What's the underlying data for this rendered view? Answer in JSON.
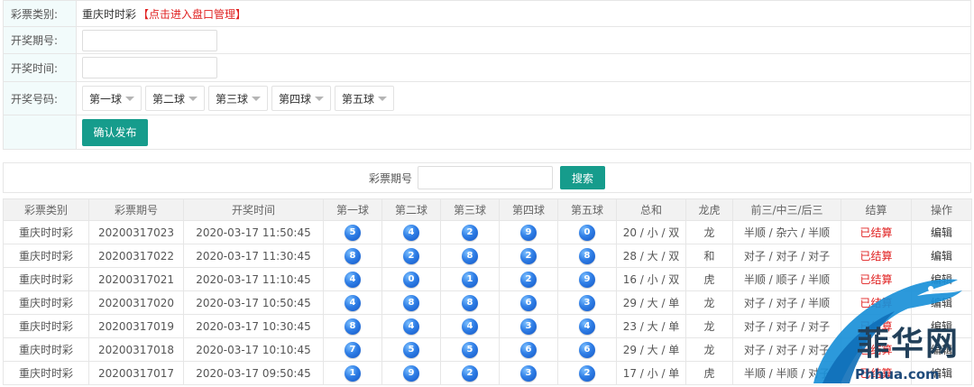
{
  "form": {
    "lottery_type_label": "彩票类别:",
    "lottery_name": "重庆时时彩",
    "lottery_link": "【点击进入盘口管理】",
    "issue_label": "开奖期号:",
    "issue_value": "",
    "time_label": "开奖时间:",
    "time_value": "",
    "numbers_label": "开奖号码:",
    "ball_selects": [
      "第一球",
      "第二球",
      "第三球",
      "第四球",
      "第五球"
    ],
    "publish_button": "确认发布"
  },
  "search": {
    "label": "彩票期号",
    "value": "",
    "button": "搜索"
  },
  "table": {
    "headers": [
      "彩票类别",
      "彩票期号",
      "开奖时间",
      "第一球",
      "第二球",
      "第三球",
      "第四球",
      "第五球",
      "总和",
      "龙虎",
      "前三/中三/后三",
      "结算",
      "操作"
    ],
    "rows": [
      {
        "type": "重庆时时彩",
        "issue": "20200317023",
        "time": "2020-03-17 11:50:45",
        "balls": [
          "5",
          "4",
          "2",
          "9",
          "0"
        ],
        "sum": "20 / 小 / 双",
        "dragon_tiger": "龙",
        "positions": "半顺 / 杂六 / 半顺",
        "status": "已结算",
        "action": "编辑"
      },
      {
        "type": "重庆时时彩",
        "issue": "20200317022",
        "time": "2020-03-17 11:30:45",
        "balls": [
          "8",
          "2",
          "8",
          "2",
          "8"
        ],
        "sum": "28 / 大 / 双",
        "dragon_tiger": "和",
        "positions": "对子 / 对子 / 对子",
        "status": "已结算",
        "action": "编辑"
      },
      {
        "type": "重庆时时彩",
        "issue": "20200317021",
        "time": "2020-03-17 11:10:45",
        "balls": [
          "4",
          "0",
          "1",
          "2",
          "9"
        ],
        "sum": "16 / 小 / 双",
        "dragon_tiger": "虎",
        "positions": "半顺 / 顺子 / 半顺",
        "status": "已结算",
        "action": "编辑"
      },
      {
        "type": "重庆时时彩",
        "issue": "20200317020",
        "time": "2020-03-17 10:50:45",
        "balls": [
          "4",
          "8",
          "8",
          "6",
          "3"
        ],
        "sum": "29 / 大 / 单",
        "dragon_tiger": "龙",
        "positions": "对子 / 对子 / 半顺",
        "status": "已结算",
        "action": "编辑"
      },
      {
        "type": "重庆时时彩",
        "issue": "20200317019",
        "time": "2020-03-17 10:30:45",
        "balls": [
          "8",
          "4",
          "4",
          "3",
          "4"
        ],
        "sum": "23 / 大 / 单",
        "dragon_tiger": "龙",
        "positions": "对子 / 对子 / 对子",
        "status": "已结算",
        "action": "编辑"
      },
      {
        "type": "重庆时时彩",
        "issue": "20200317018",
        "time": "2020-03-17 10:10:45",
        "balls": [
          "7",
          "5",
          "5",
          "6",
          "6"
        ],
        "sum": "29 / 大 / 单",
        "dragon_tiger": "龙",
        "positions": "对子 / 对子 / 对子",
        "status": "已结算",
        "action": "编辑"
      },
      {
        "type": "重庆时时彩",
        "issue": "20200317017",
        "time": "2020-03-17 09:50:45",
        "balls": [
          "1",
          "9",
          "2",
          "3",
          "2"
        ],
        "sum": "17 / 小 / 单",
        "dragon_tiger": "虎",
        "positions": "半顺 / 半顺 / 对子",
        "status": "已结算",
        "action": "编辑"
      }
    ]
  },
  "watermark": {
    "text": "菲华网",
    "url": "Phhua.com"
  },
  "colors": {
    "accent": "#169c8c",
    "link_red": "#e02020",
    "ball_blue": "#2f7ee6"
  }
}
